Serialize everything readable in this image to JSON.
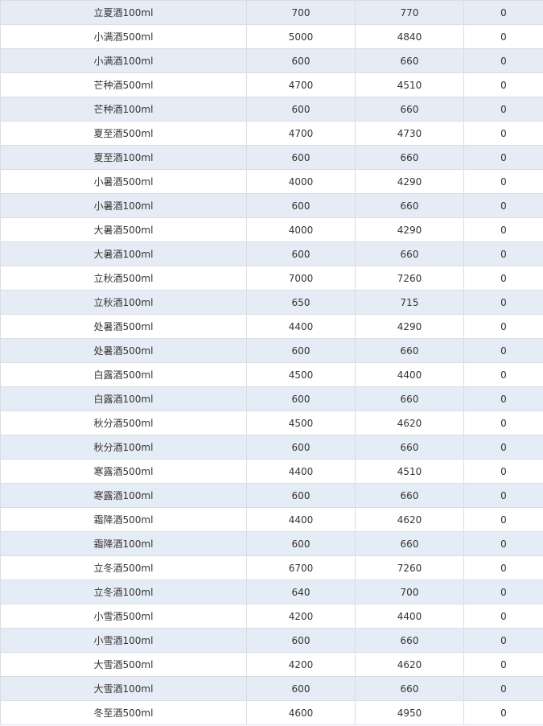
{
  "table": {
    "rows": [
      [
        "立夏酒100ml",
        "700",
        "770",
        "0"
      ],
      [
        "小满酒500ml",
        "5000",
        "4840",
        "0"
      ],
      [
        "小满酒100ml",
        "600",
        "660",
        "0"
      ],
      [
        "芒种酒500ml",
        "4700",
        "4510",
        "0"
      ],
      [
        "芒种酒100ml",
        "600",
        "660",
        "0"
      ],
      [
        "夏至酒500ml",
        "4700",
        "4730",
        "0"
      ],
      [
        "夏至酒100ml",
        "600",
        "660",
        "0"
      ],
      [
        "小暑酒500ml",
        "4000",
        "4290",
        "0"
      ],
      [
        "小暑酒100ml",
        "600",
        "660",
        "0"
      ],
      [
        "大暑酒500ml",
        "4000",
        "4290",
        "0"
      ],
      [
        "大暑酒100ml",
        "600",
        "660",
        "0"
      ],
      [
        "立秋酒500ml",
        "7000",
        "7260",
        "0"
      ],
      [
        "立秋酒100ml",
        "650",
        "715",
        "0"
      ],
      [
        "处暑酒500ml",
        "4400",
        "4290",
        "0"
      ],
      [
        "处暑酒500ml",
        "600",
        "660",
        "0"
      ],
      [
        "白露酒500ml",
        "4500",
        "4400",
        "0"
      ],
      [
        "白露酒100ml",
        "600",
        "660",
        "0"
      ],
      [
        "秋分酒500ml",
        "4500",
        "4620",
        "0"
      ],
      [
        "秋分酒100ml",
        "600",
        "660",
        "0"
      ],
      [
        "寒露酒500ml",
        "4400",
        "4510",
        "0"
      ],
      [
        "寒露酒100ml",
        "600",
        "660",
        "0"
      ],
      [
        "霜降酒500ml",
        "4400",
        "4620",
        "0"
      ],
      [
        "霜降酒100ml",
        "600",
        "660",
        "0"
      ],
      [
        "立冬酒500ml",
        "6700",
        "7260",
        "0"
      ],
      [
        "立冬酒100ml",
        "640",
        "700",
        "0"
      ],
      [
        "小雪酒500ml",
        "4200",
        "4400",
        "0"
      ],
      [
        "小雪酒100ml",
        "600",
        "660",
        "0"
      ],
      [
        "大雪酒500ml",
        "4200",
        "4620",
        "0"
      ],
      [
        "大雪酒100ml",
        "600",
        "660",
        "0"
      ],
      [
        "冬至酒500ml",
        "4600",
        "4950",
        "0"
      ]
    ]
  }
}
